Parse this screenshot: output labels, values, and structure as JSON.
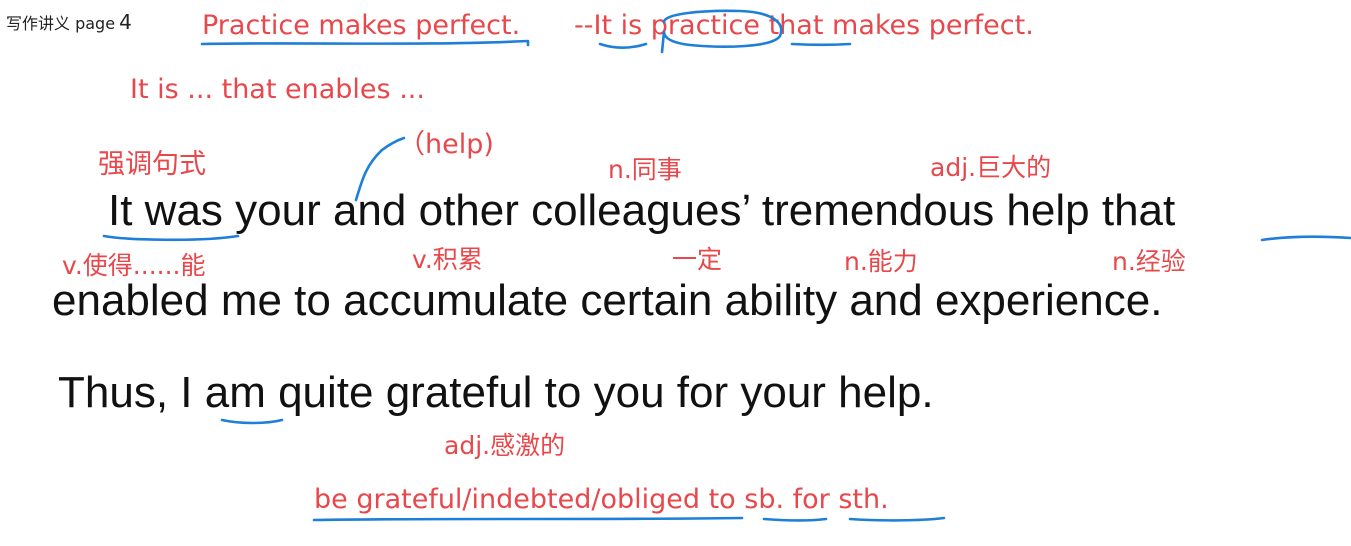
{
  "header": {
    "label": "写作讲义 page",
    "page_number": "4"
  },
  "notes": {
    "practice_line": "Practice makes perfect.",
    "emphasis_prefix": "--",
    "emphasis_it_is": "It is",
    "emphasis_practice": "practice",
    "emphasis_that": "that",
    "emphasis_rest": "makes perfect.",
    "pattern": "It is ... that enables ...",
    "qiangdiao": "强调句式",
    "help_hint": "（help)",
    "tongshi": "n.同事",
    "judade": "adj.巨大的",
    "shide": "v.使得......能",
    "jilei": "v.积累",
    "yiding": "一定",
    "nengli": "n.能力",
    "jingyan": "n.经验",
    "ganji": "adj.感激的",
    "phrase": "be grateful/indebted/obliged to sb. for sth."
  },
  "sentences": {
    "line1": "It was your and other colleagues’ tremendous help that",
    "line2": "enabled me to accumulate certain ability and experience.",
    "line3": "Thus, I am quite grateful to you for your help."
  },
  "colors": {
    "annotation_red": "#e8474b",
    "ink_blue": "#1e7fd8",
    "text": "#111111"
  }
}
